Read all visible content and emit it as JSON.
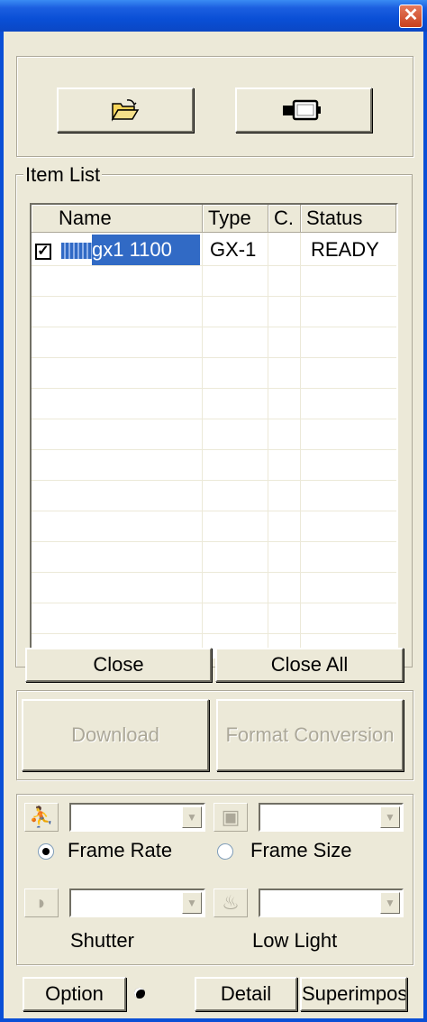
{
  "window": {
    "close_glyph": "✕"
  },
  "toolbar": {
    "open_icon": "folder-open-icon",
    "device_icon": "device-icon"
  },
  "item_list": {
    "legend": "Item List",
    "columns": [
      "Name",
      "Type",
      "C.",
      "Status"
    ],
    "rows": [
      {
        "checked": true,
        "name": "gx1 1100",
        "type": "GX-1",
        "c": "",
        "status": "READY"
      }
    ]
  },
  "buttons": {
    "close": "Close",
    "close_all": "Close All",
    "download": "Download",
    "format_conversion": "Format Conversion",
    "option": "Option",
    "detail": "Detail",
    "superimpose": "Superimpose"
  },
  "settings": {
    "frame_rate_label": "Frame Rate",
    "frame_size_label": "Frame Size",
    "selected_mode": "Frame Rate",
    "shutter_label": "Shutter",
    "low_light_label": "Low Light"
  },
  "colors": {
    "title_blue": "#0a4fd6",
    "selection": "#316ac5",
    "face": "#ece9d8"
  }
}
